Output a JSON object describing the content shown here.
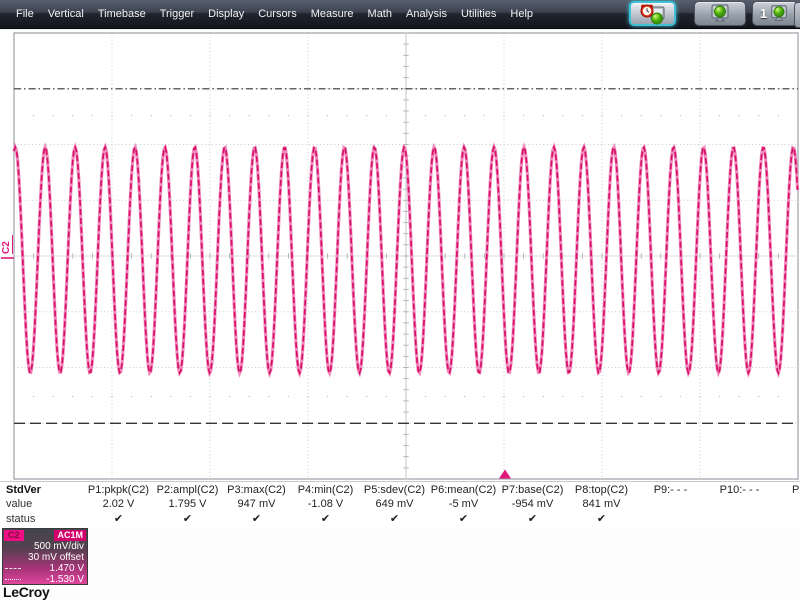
{
  "menu": {
    "items": [
      "File",
      "Vertical",
      "Timebase",
      "Trigger",
      "Display",
      "Cursors",
      "Measure",
      "Math",
      "Analysis",
      "Utilities",
      "Help"
    ]
  },
  "toolbar": {
    "button3_label": "1",
    "buttons": [
      {
        "id": "timer-scope-button",
        "selected": true
      },
      {
        "id": "scope-display-button",
        "selected": false
      },
      {
        "id": "scope-display-1-button",
        "selected": false
      }
    ]
  },
  "measure": {
    "mode_label": "StdVer",
    "value_label": "value",
    "status_label": "status",
    "overflow_label": "P",
    "params": [
      {
        "label": "P1:pkpk(C2)",
        "value": "2.02 V",
        "status": "✔"
      },
      {
        "label": "P2:ampl(C2)",
        "value": "1.795 V",
        "status": "✔"
      },
      {
        "label": "P3:max(C2)",
        "value": "947 mV",
        "status": "✔"
      },
      {
        "label": "P4:min(C2)",
        "value": "-1.08 V",
        "status": "✔"
      },
      {
        "label": "P5:sdev(C2)",
        "value": "649 mV",
        "status": "✔"
      },
      {
        "label": "P6:mean(C2)",
        "value": "-5 mV",
        "status": "✔"
      },
      {
        "label": "P7:base(C2)",
        "value": "-954 mV",
        "status": "✔"
      },
      {
        "label": "P8:top(C2)",
        "value": "841 mV",
        "status": "✔"
      },
      {
        "label": "P9:- - -",
        "value": "",
        "status": ""
      },
      {
        "label": "P10:- - -",
        "value": "",
        "status": ""
      }
    ]
  },
  "channel_box": {
    "channel": "C2",
    "coupling": "AC1M",
    "scale": "500 mV/div",
    "offset": "30 mV offset",
    "level_top": "1.470 V",
    "level_bottom": "-1.530 V"
  },
  "logo": "LeCroy",
  "scope": {
    "channel_label": "C2"
  },
  "chart_data": {
    "type": "line",
    "signal_shape": "sine",
    "cycles_visible": 26.2,
    "peak_v": 0.947,
    "trough_v": -1.08,
    "mean_v": -0.005,
    "volts_per_div": 0.5,
    "offset_volts": 0.03,
    "divisions": {
      "horizontal": 8,
      "vertical": 8
    },
    "cursor_levels_v": {
      "top": 1.47,
      "bottom": -1.53
    }
  },
  "colors": {
    "trace_light": "#f08cbd",
    "trace": "#d80f66",
    "accent": "#e0187a",
    "grid": "#c7cad0",
    "grid_border": "#9ca1a8",
    "cursor_line": "#353535"
  }
}
